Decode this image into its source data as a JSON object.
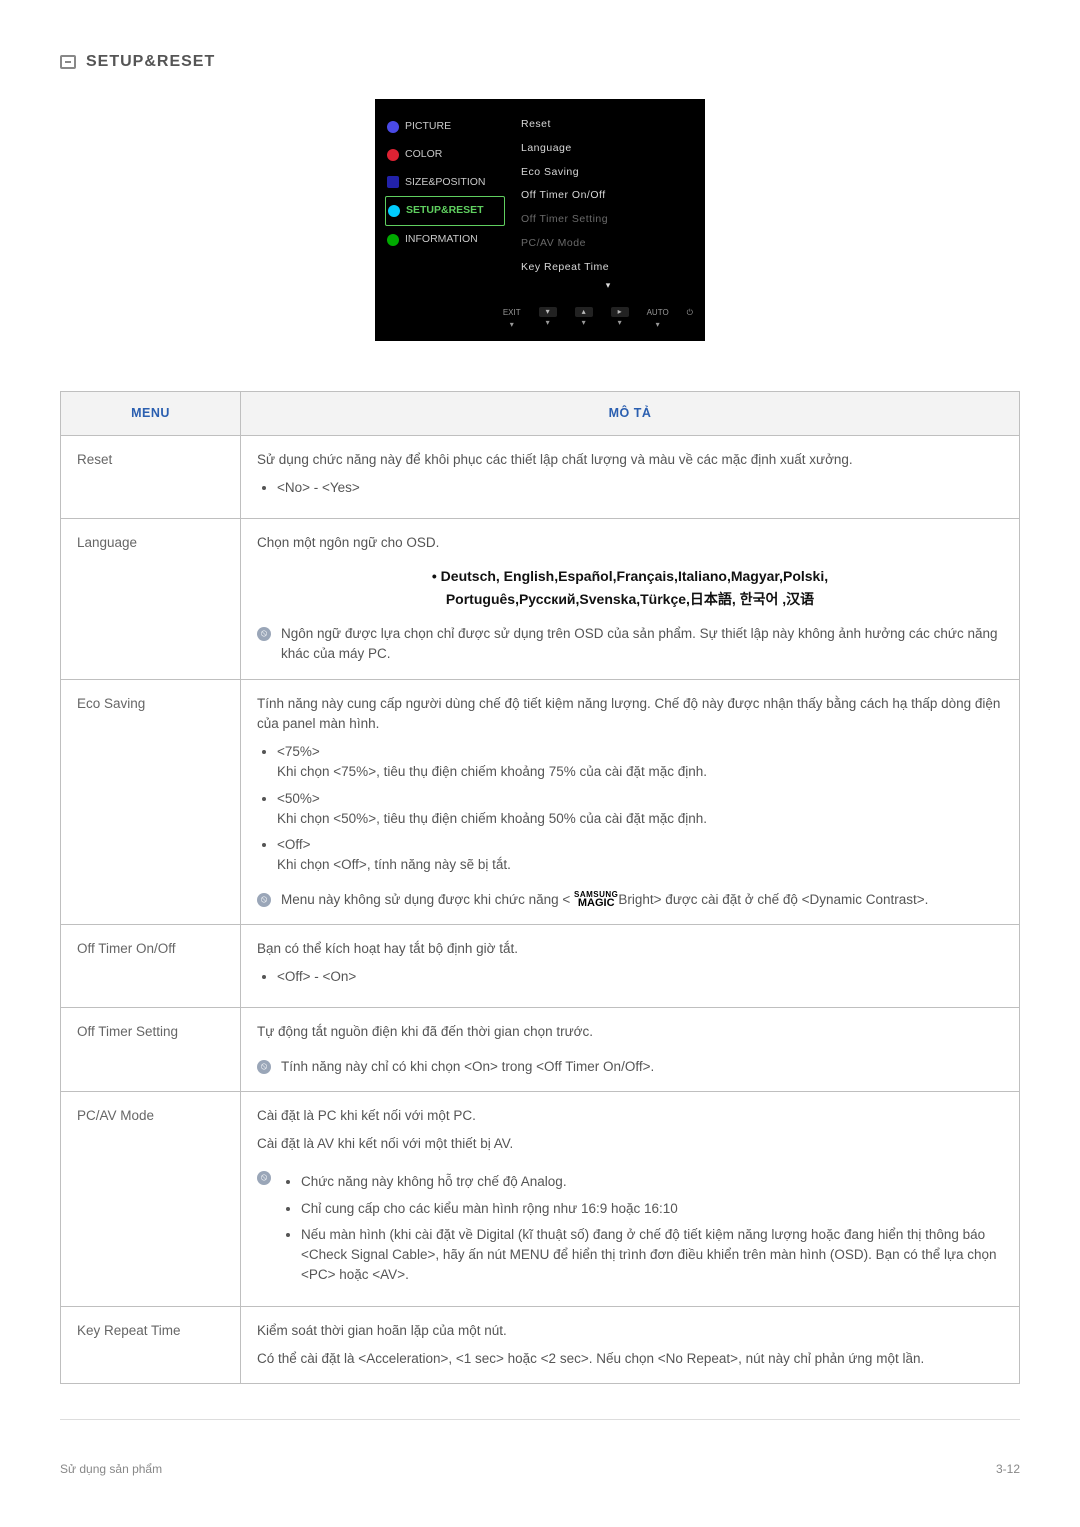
{
  "page": {
    "title": "SETUP&RESET"
  },
  "osd": {
    "left": {
      "picture": "PICTURE",
      "color": "COLOR",
      "size": "SIZE&POSITION",
      "setup": "SETUP&RESET",
      "info": "INFORMATION"
    },
    "right": {
      "reset": "Reset",
      "language": "Language",
      "eco": "Eco Saving",
      "offtimer": "Off Timer On/Off",
      "offtimerset": "Off Timer Setting",
      "pcav": "PC/AV Mode",
      "keyrepeat": "Key Repeat Time"
    },
    "footer": {
      "exit": "EXIT",
      "auto": "AUTO"
    }
  },
  "table": {
    "head": {
      "menu": "MENU",
      "desc": "MÔ TẢ"
    },
    "rows": {
      "reset": {
        "label": "Reset",
        "body": "Sử dụng chức năng này để khôi phục các thiết lập chất lượng và màu về các mặc định xuất xưởng.",
        "opt": "<No> - <Yes>"
      },
      "language": {
        "label": "Language",
        "body": "Chọn một ngôn ngữ cho OSD.",
        "langs1": "• Deutsch, English,Español,Français,Italiano,Magyar,Polski,",
        "langs2": "Português,Русский,Svenska,Türkçe,日本語, 한국어 ,汉语",
        "note": "Ngôn ngữ được lựa chọn chỉ được sử dụng trên OSD của sản phẩm. Sự thiết lập này không ảnh hưởng các chức năng khác của máy PC."
      },
      "eco": {
        "label": "Eco Saving",
        "body": "Tính năng này cung cấp người dùng chế độ tiết kiệm năng lượng. Chế độ này được nhận thấy bằng cách hạ thấp dòng điện của panel màn hình.",
        "o1a": "<75%>",
        "o1b": "Khi chọn <75%>, tiêu thụ điện chiếm khoảng 75% của cài đặt mặc định.",
        "o2a": "<50%>",
        "o2b": "Khi chọn <50%>, tiêu thụ điện chiếm khoảng 50% của cài đặt mặc định.",
        "o3a": "<Off>",
        "o3b": "Khi chọn <Off>, tính năng này sẽ bị tắt.",
        "notePre": "Menu này không sử dụng được khi chức năng < ",
        "notePost": "Bright> được cài đặt ở chế độ <Dynamic Contrast>.",
        "brandTop": "SAMSUNG",
        "brandBot": "MAGIC"
      },
      "offtimer": {
        "label": "Off Timer On/Off",
        "body": "Bạn có thể kích hoạt hay tắt bộ định giờ tắt.",
        "opt": "<Off> - <On>"
      },
      "offtimerset": {
        "label": "Off Timer Setting",
        "body": "Tự động tắt nguồn điện khi đã đến thời gian chọn trước.",
        "note": "Tính năng này chỉ có khi chọn <On> trong <Off Timer On/Off>."
      },
      "pcav": {
        "label": "PC/AV Mode",
        "b1": "Cài đặt là PC khi kết nối với một PC.",
        "b2": "Cài đặt là AV khi kết nối với một thiết bị AV.",
        "n1": "Chức năng này không hỗ trợ chế độ Analog.",
        "n2": "Chỉ cung cấp cho các kiểu màn hình rộng như 16:9 hoặc 16:10",
        "n3": "Nếu màn hình (khi cài đặt về Digital (kĩ thuật số) đang ở chế độ tiết kiệm năng lượng hoặc đang hiển thị thông báo <Check Signal Cable>, hãy ấn nút MENU để hiển thị trình đơn điều khiển trên màn hình (OSD). Bạn có thể lựa chọn <PC> hoặc <AV>."
      },
      "keyrepeat": {
        "label": "Key Repeat Time",
        "b1": "Kiểm soát thời gian hoãn lặp của một nút.",
        "b2": "Có thể cài đặt là <Acceleration>, <1 sec> hoặc <2 sec>. Nếu chọn <No Repeat>, nút này chỉ phản ứng một lần."
      }
    }
  },
  "footer": {
    "left": "Sử dụng sản phẩm",
    "right": "3-12"
  }
}
